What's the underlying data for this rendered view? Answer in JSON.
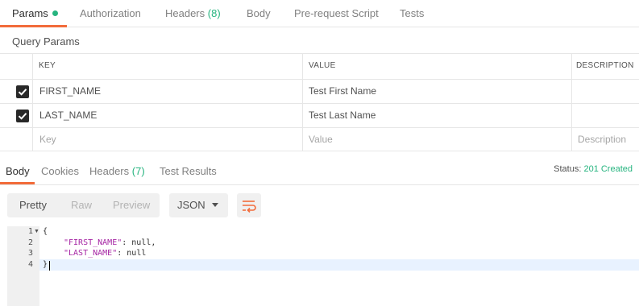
{
  "request_tabs": [
    {
      "label": "Params",
      "count": ""
    },
    {
      "label": "Authorization",
      "count": ""
    },
    {
      "label": "Headers",
      "count": "(8)"
    },
    {
      "label": "Body",
      "count": ""
    },
    {
      "label": "Pre-request Script",
      "count": ""
    },
    {
      "label": "Tests",
      "count": ""
    }
  ],
  "query_params": {
    "title": "Query Params",
    "columns": [
      "KEY",
      "VALUE",
      "DESCRIPTION"
    ],
    "rows": [
      {
        "checked": true,
        "key": "FIRST_NAME",
        "value": "Test First Name",
        "description": ""
      },
      {
        "checked": true,
        "key": "LAST_NAME",
        "value": "Test Last Name",
        "description": ""
      }
    ],
    "placeholders": {
      "key": "Key",
      "value": "Value",
      "description": "Description"
    }
  },
  "response_tabs": [
    {
      "label": "Body",
      "count": ""
    },
    {
      "label": "Cookies",
      "count": ""
    },
    {
      "label": "Headers",
      "count": "(7)"
    },
    {
      "label": "Test Results",
      "count": ""
    }
  ],
  "status": {
    "label": "Status:",
    "value": "201 Created"
  },
  "view_modes": [
    "Pretty",
    "Raw",
    "Preview"
  ],
  "format": "JSON",
  "code": {
    "line_numbers": [
      "1",
      "2",
      "3",
      "4"
    ],
    "open_brace": "{",
    "close_brace": "}",
    "entries": [
      {
        "key": "\"FIRST_NAME\"",
        "rest": ": null,"
      },
      {
        "key": "\"LAST_NAME\"",
        "rest": ": null"
      }
    ]
  },
  "colors": {
    "accent": "#f26b3a",
    "success": "#26b47f"
  }
}
